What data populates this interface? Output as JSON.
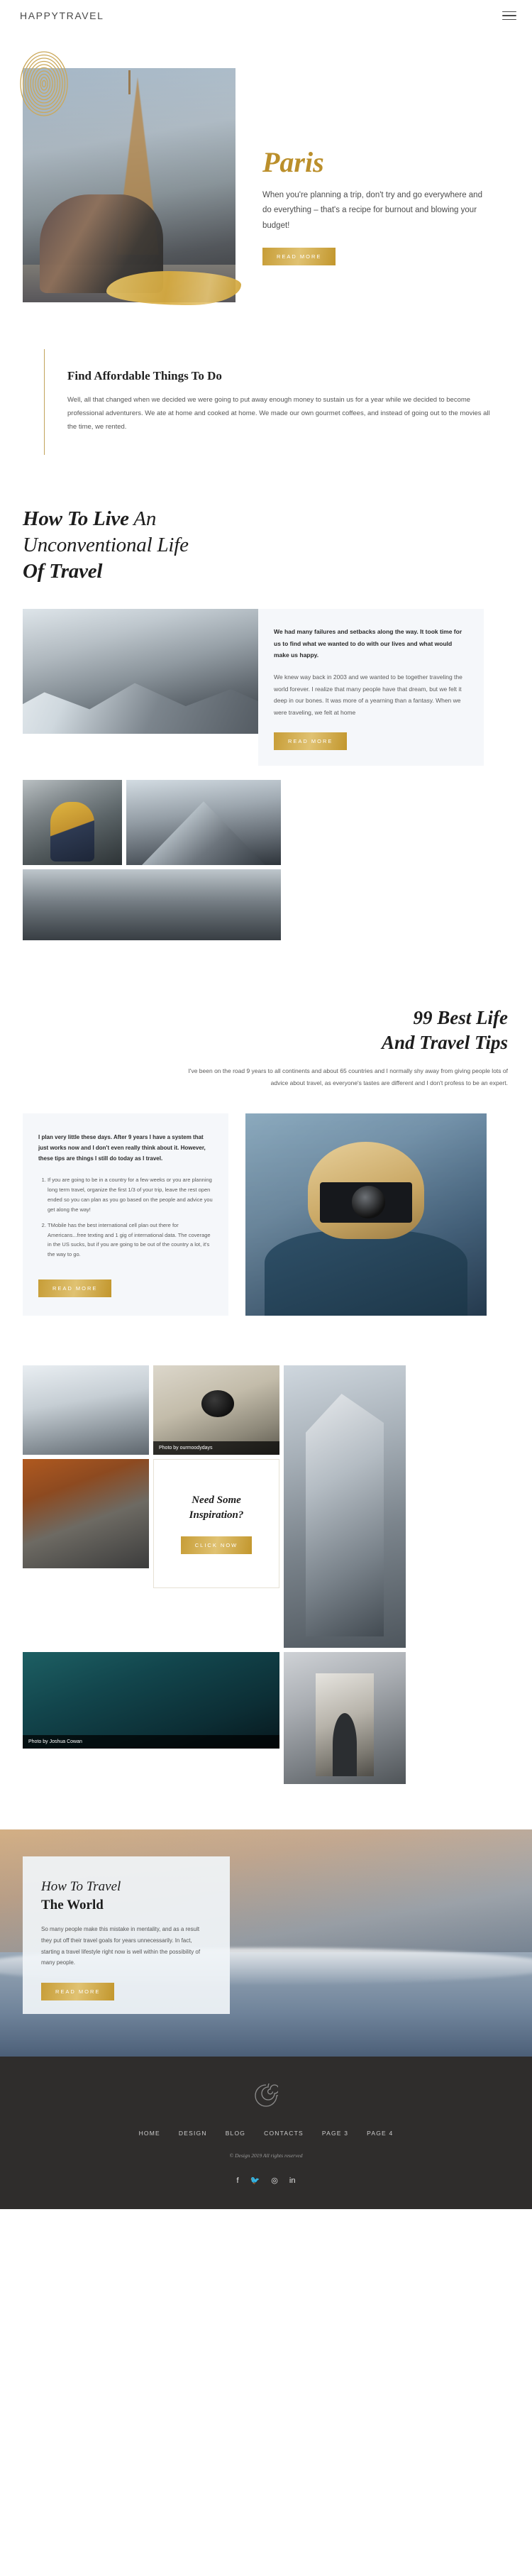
{
  "header": {
    "brand": "HAPPYTRAVEL",
    "menu_icon": "hamburger-menu-icon"
  },
  "hero": {
    "title": "Paris",
    "subtitle": "When you're planning a trip, don't try and go everywhere and do everything – that's a recipe for burnout and blowing your budget!",
    "button": "READ MORE"
  },
  "quote": {
    "heading": "Find Affordable Things To Do",
    "body": "Well, all that changed when we decided we were going to put away enough money to sustain us for a year while we decided to become professional adventurers. We ate at home and cooked at home. We made our own gourmet coffees, and instead of going out to the movies all the time, we rented."
  },
  "unconventional": {
    "title_line1_bold": "How To Live",
    "title_line1_rest": " An",
    "title_line2": "Unconventional Life",
    "title_line3": "Of Travel",
    "lead": "We had many failures and setbacks along the way. It took time for us to find what we wanted to do with our lives and what would make us happy.",
    "body": "We knew way back in 2003 and we wanted to be together traveling the world forever. I realize that many people have that dream, but we felt it deep in our bones. It was more of a yearning than a fantasy. When we were traveling, we felt at home",
    "button": "READ MORE"
  },
  "tips": {
    "title_line1": "99 Best Life",
    "title_line2": "And Travel Tips",
    "intro": "I've been on the road 9 years to all continents and about 65 countries and I normally shy away from giving people lots of advice about travel, as everyone's tastes are different and I don't profess to be an expert.",
    "lead": "I plan very little these days. After 9 years I have a system that just works now and I don't even really think about it. However, these tips are things I still do today as I travel.",
    "items": [
      "If you are going to be in a country for a few weeks or you are planning long term travel, organize the first 1/3 of your trip, leave the rest open ended so you can plan as you go based on the people and advice you get along the way!",
      "TMobile has the best international cell plan out there for Americans...free texting and 1 gig of international data. The coverage in the US sucks, but if you are going to be out of the country a lot, it's the way to go."
    ],
    "button": "READ MORE"
  },
  "gallery": {
    "caption_map": "Photo by ourmoodydays",
    "caption_cave": "Photo by Joshua Cowan",
    "inspiration_line1": "Need Some",
    "inspiration_line2": "Inspiration?",
    "inspiration_button": "CLICK NOW"
  },
  "world": {
    "title_line1": "How To Travel",
    "title_line2": "The World",
    "body": "So many people make this mistake in mentality, and as a result they put off their travel goals for years unnecessarily. In fact, starting a travel lifestyle right now is well within the possibility of many people.",
    "button": "READ MORE"
  },
  "footer": {
    "logo_icon": "spiral-logo-icon",
    "nav": [
      "HOME",
      "DESIGN",
      "BLOG",
      "CONTACTS",
      "PAGE 3",
      "PAGE 4"
    ],
    "copyright": "© Design 2019 All rights reserved",
    "social": [
      {
        "name": "facebook-icon",
        "glyph": "f"
      },
      {
        "name": "twitter-icon",
        "glyph": "🐦"
      },
      {
        "name": "instagram-icon",
        "glyph": "◎"
      },
      {
        "name": "linkedin-icon",
        "glyph": "in"
      }
    ]
  },
  "colors": {
    "gold": "#bb8f2b",
    "dark": "#2f2d2c",
    "panel": "#f5f7fa"
  }
}
